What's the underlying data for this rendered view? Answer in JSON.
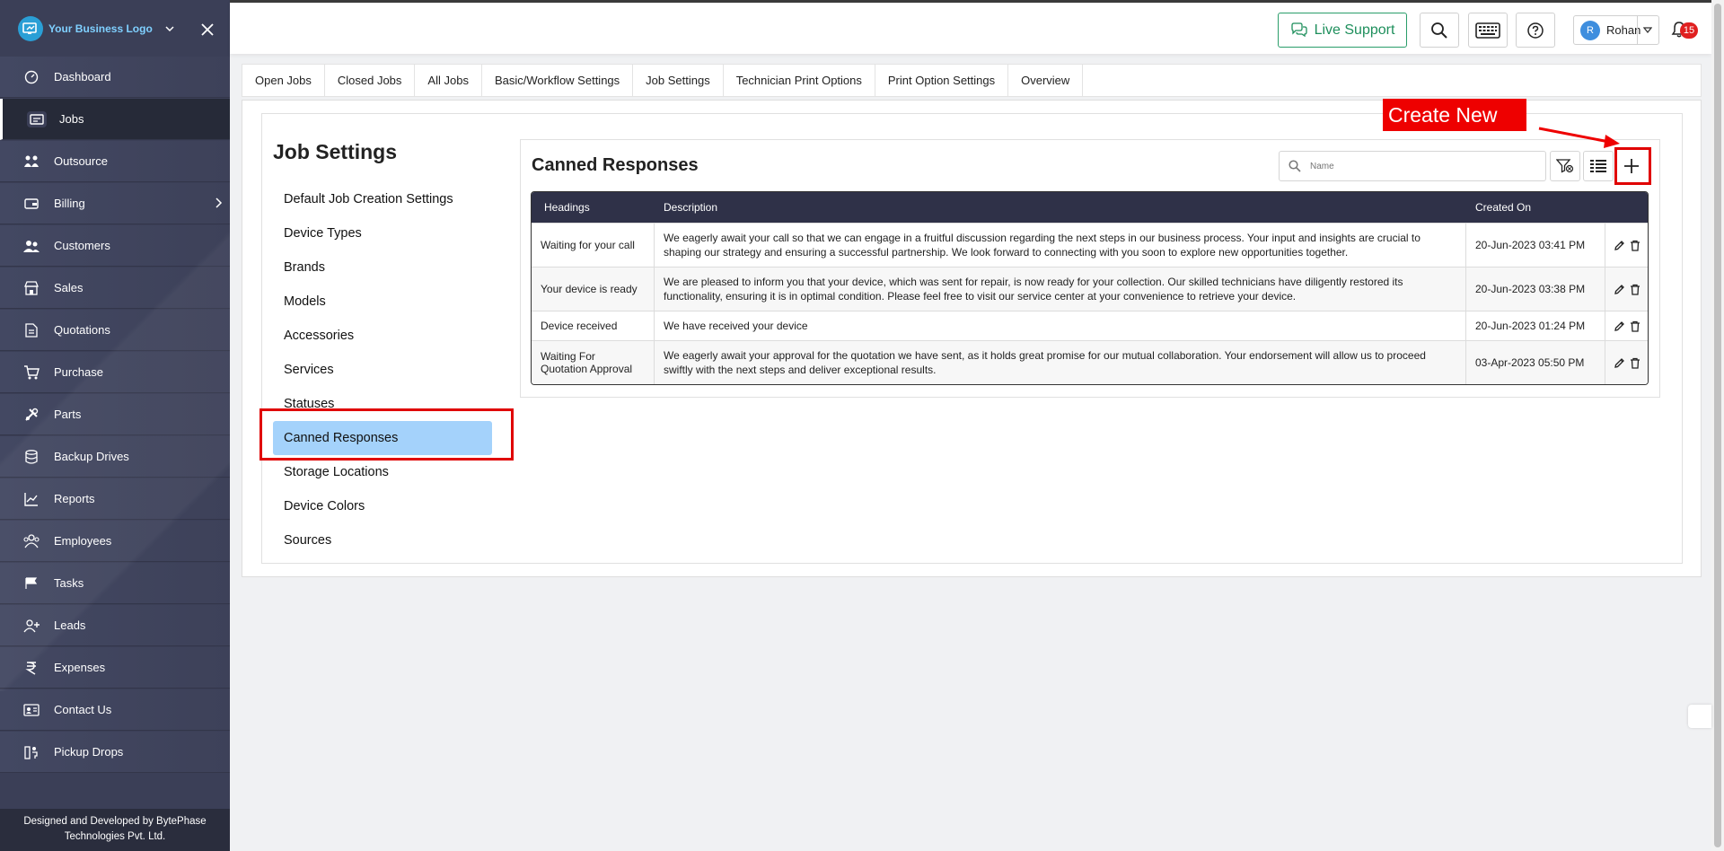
{
  "brand": {
    "name": "Your Business Logo"
  },
  "sidebar": {
    "items": [
      {
        "label": "Dashboard",
        "icon": "dashboard-icon"
      },
      {
        "label": "Jobs",
        "icon": "jobs-icon",
        "active": true
      },
      {
        "label": "Outsource",
        "icon": "outsource-icon"
      },
      {
        "label": "Billing",
        "icon": "billing-icon",
        "has_submenu": true
      },
      {
        "label": "Customers",
        "icon": "customers-icon"
      },
      {
        "label": "Sales",
        "icon": "sales-icon"
      },
      {
        "label": "Quotations",
        "icon": "quotations-icon"
      },
      {
        "label": "Purchase",
        "icon": "cart-icon"
      },
      {
        "label": "Parts",
        "icon": "parts-icon"
      },
      {
        "label": "Backup Drives",
        "icon": "database-icon"
      },
      {
        "label": "Reports",
        "icon": "reports-icon"
      },
      {
        "label": "Employees",
        "icon": "employees-icon"
      },
      {
        "label": "Tasks",
        "icon": "tasks-icon"
      },
      {
        "label": "Leads",
        "icon": "leads-icon"
      },
      {
        "label": "Expenses",
        "icon": "rupee-icon"
      },
      {
        "label": "Contact Us",
        "icon": "contact-icon"
      },
      {
        "label": "Pickup Drops",
        "icon": "pickup-icon"
      }
    ],
    "footer_line1": "Designed and Developed by BytePhase",
    "footer_line2": "Technologies Pvt. Ltd."
  },
  "topbar": {
    "live_support": "Live Support",
    "user_initial": "R",
    "user_name": "Rohan",
    "notification_count": "15"
  },
  "tabs": [
    "Open Jobs",
    "Closed Jobs",
    "All Jobs",
    "Basic/Workflow Settings",
    "Job Settings",
    "Technician Print Options",
    "Print Option Settings",
    "Overview"
  ],
  "settings": {
    "title": "Job Settings",
    "items": [
      "Default Job Creation Settings",
      "Device Types",
      "Brands",
      "Models",
      "Accessories",
      "Services",
      "Statuses",
      "Canned Responses",
      "Storage Locations",
      "Device Colors",
      "Sources"
    ],
    "active_index": 7
  },
  "canned": {
    "title": "Canned Responses",
    "search_placeholder": "Name",
    "annotation": "Create New",
    "columns": [
      "Headings",
      "Description",
      "Created On"
    ],
    "rows": [
      {
        "heading": "Waiting for your call",
        "description": "We eagerly await your call so that we can engage in a fruitful discussion regarding the next steps in our business process. Your input and insights are crucial to shaping our strategy and ensuring a successful partnership. We look forward to connecting with you soon to explore new opportunities together.",
        "created": "20-Jun-2023 03:41 PM"
      },
      {
        "heading": "Your device is ready",
        "description": "We are pleased to inform you that your device, which was sent for repair, is now ready for your collection. Our skilled technicians have diligently restored its functionality, ensuring it is in optimal condition. Please feel free to visit our service center at your convenience to retrieve your device.",
        "created": "20-Jun-2023 03:38 PM"
      },
      {
        "heading": "Device received",
        "description": "We have received your device",
        "created": "20-Jun-2023 01:24 PM"
      },
      {
        "heading": "Waiting For Quotation Approval",
        "description": "We eagerly await your approval for the quotation we have sent, as it holds great promise for our mutual collaboration. Your endorsement will allow us to proceed swiftly with the next steps and deliver exceptional results.",
        "created": "03-Apr-2023 05:50 PM"
      }
    ]
  },
  "colors": {
    "sidebar_bg": "#3b3f57",
    "table_header": "#2f3148",
    "active_setting": "#a4d2fb",
    "annotation_red": "#ee0000",
    "live_support_green": "#1e8f5c"
  }
}
